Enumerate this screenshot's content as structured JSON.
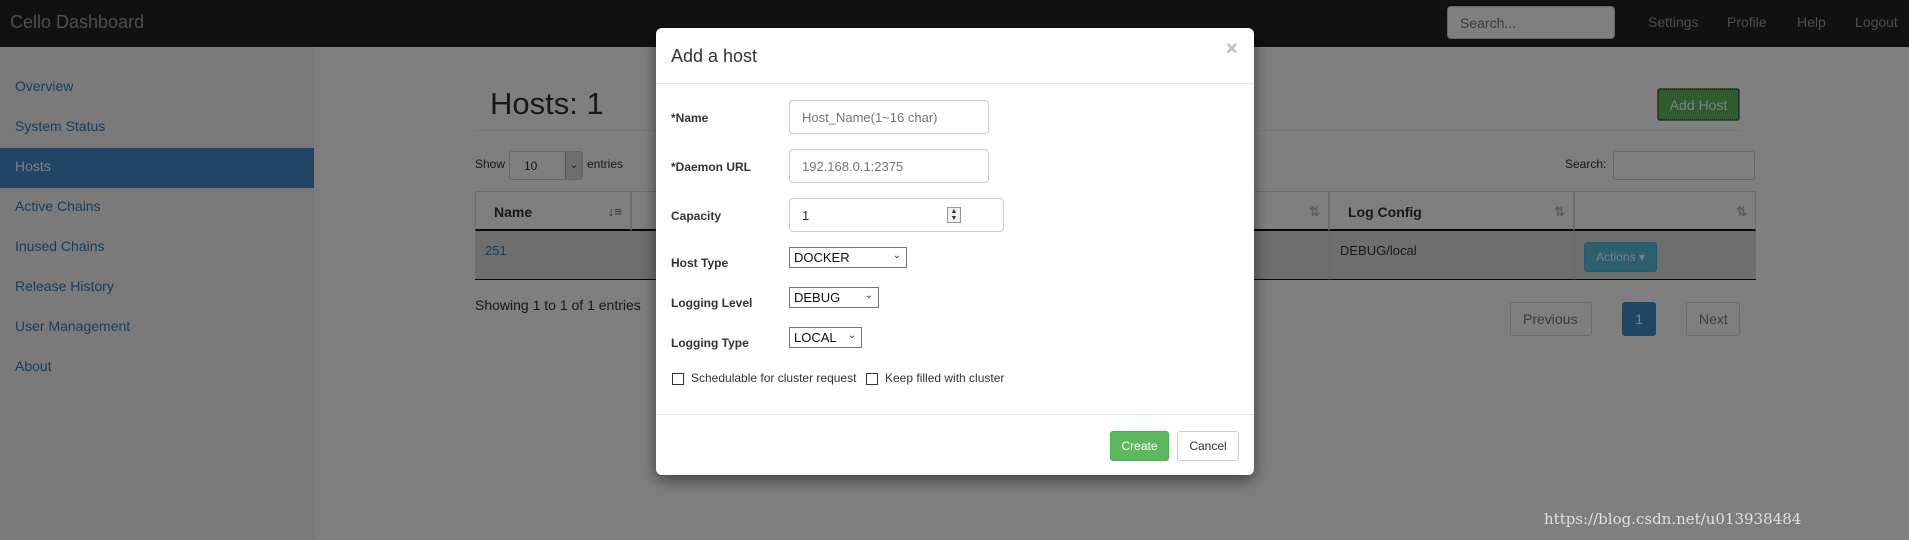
{
  "navbar": {
    "brand": "Cello Dashboard",
    "search_placeholder": "Search...",
    "links": [
      "Settings",
      "Profile",
      "Help",
      "Logout"
    ]
  },
  "sidebar": {
    "items": [
      {
        "label": "Overview"
      },
      {
        "label": "System Status"
      },
      {
        "label": "Hosts",
        "active": true
      },
      {
        "label": "Active Chains"
      },
      {
        "label": "Inused Chains"
      },
      {
        "label": "Release History"
      },
      {
        "label": "User Management"
      },
      {
        "label": "About"
      }
    ]
  },
  "main": {
    "title": "Hosts: 1",
    "add_button": "Add Host",
    "show_label": "Show",
    "show_value": "10",
    "entries_label": "entries",
    "search_label": "Search:",
    "table": {
      "headers": [
        "Name",
        "Log Config"
      ],
      "rows": [
        {
          "name": "251",
          "log_config": "DEBUG/local",
          "action": "Actions"
        }
      ]
    },
    "info": "Showing 1 to 1 of 1 entries",
    "pagination": {
      "previous": "Previous",
      "current": "1",
      "next": "Next"
    }
  },
  "modal": {
    "title": "Add a host",
    "close": "×",
    "fields": {
      "name_label": "*Name",
      "name_placeholder": "Host_Name(1~16 char)",
      "url_label": "*Daemon URL",
      "url_placeholder": "192.168.0.1:2375",
      "capacity_label": "Capacity",
      "capacity_value": "1",
      "host_type_label": "Host Type",
      "host_type_value": "DOCKER",
      "log_level_label": "Logging Level",
      "log_level_value": "DEBUG",
      "log_type_label": "Logging Type",
      "log_type_value": "LOCAL"
    },
    "checkboxes": [
      "Schedulable for cluster request",
      "Keep filled with cluster"
    ],
    "create": "Create",
    "cancel": "Cancel"
  },
  "watermark": "https://blog.csdn.net/u013938484",
  "colors": {
    "primary": "#428bca",
    "success": "#5cb85c",
    "info": "#5bc0de",
    "navbar": "#222222"
  }
}
